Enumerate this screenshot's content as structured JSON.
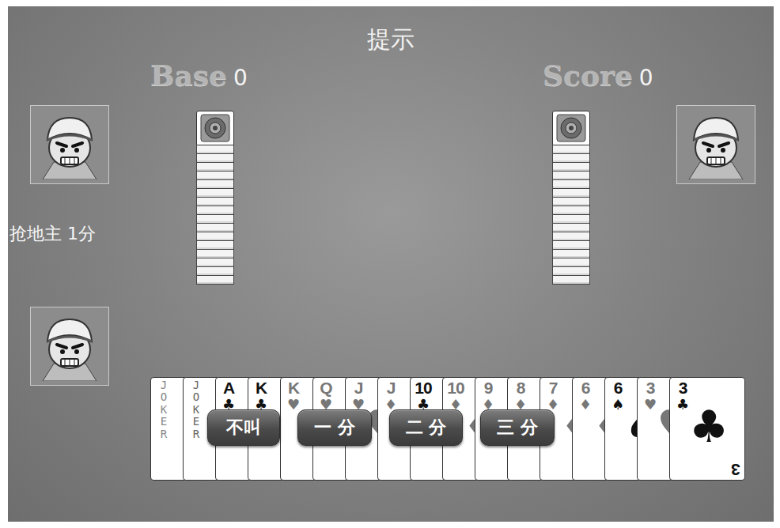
{
  "title": "提示",
  "base": {
    "label": "Base",
    "value": "0"
  },
  "score": {
    "label": "Score",
    "value": "0"
  },
  "bid_message": "抢地主 1分",
  "opponents": [
    {
      "cards": 17
    },
    {
      "cards": 17
    }
  ],
  "hand": [
    {
      "kind": "joker",
      "rank": "JOKER",
      "suit": "",
      "color": "#888888"
    },
    {
      "kind": "joker",
      "rank": "JOKER",
      "suit": "",
      "color": "#666666"
    },
    {
      "kind": "number",
      "rank": "A",
      "suit": "♣",
      "color": "#111111"
    },
    {
      "kind": "number",
      "rank": "K",
      "suit": "♣",
      "color": "#111111"
    },
    {
      "kind": "number",
      "rank": "K",
      "suit": "♥",
      "color": "#777777"
    },
    {
      "kind": "number",
      "rank": "Q",
      "suit": "♥",
      "color": "#777777"
    },
    {
      "kind": "number",
      "rank": "J",
      "suit": "♥",
      "color": "#777777"
    },
    {
      "kind": "number",
      "rank": "J",
      "suit": "♦",
      "color": "#777777"
    },
    {
      "kind": "number",
      "rank": "10",
      "suit": "♣",
      "color": "#111111"
    },
    {
      "kind": "number",
      "rank": "10",
      "suit": "♦",
      "color": "#777777"
    },
    {
      "kind": "number",
      "rank": "9",
      "suit": "♦",
      "color": "#777777"
    },
    {
      "kind": "number",
      "rank": "8",
      "suit": "♦",
      "color": "#777777"
    },
    {
      "kind": "number",
      "rank": "7",
      "suit": "♦",
      "color": "#777777"
    },
    {
      "kind": "number",
      "rank": "6",
      "suit": "♦",
      "color": "#777777"
    },
    {
      "kind": "number",
      "rank": "6",
      "suit": "♠",
      "color": "#111111"
    },
    {
      "kind": "number",
      "rank": "3",
      "suit": "♥",
      "color": "#777777"
    },
    {
      "kind": "number",
      "rank": "3",
      "suit": "♣",
      "color": "#111111"
    }
  ],
  "buttons": [
    "不叫",
    "一 分",
    "二 分",
    "三 分"
  ]
}
